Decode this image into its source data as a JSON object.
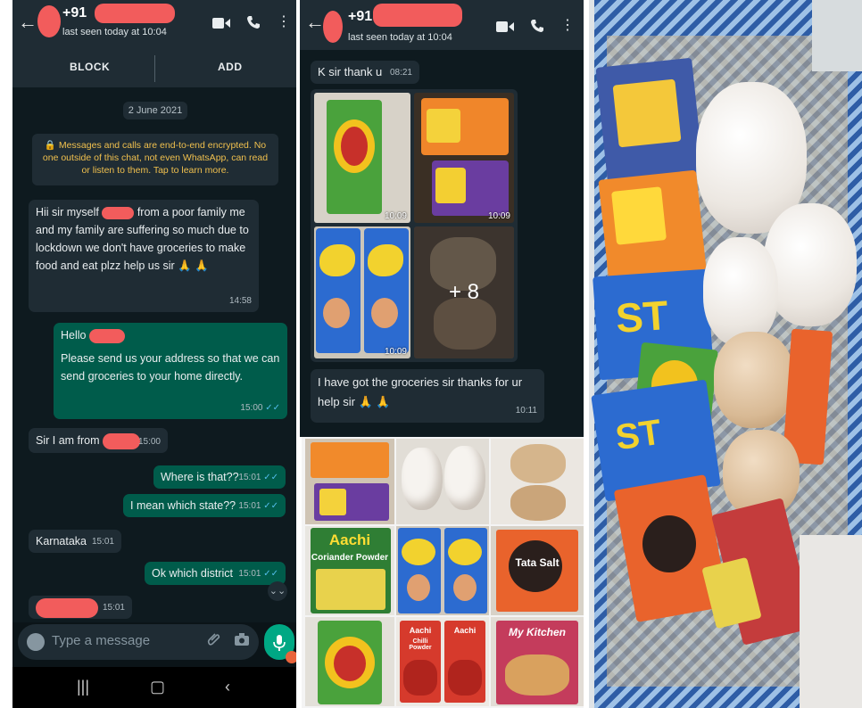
{
  "chat1": {
    "header": {
      "number_prefix": "+91",
      "last_seen": "last seen today at 10:04"
    },
    "actions": {
      "block": "BLOCK",
      "add": "ADD"
    },
    "date_chip": "2 June 2021",
    "encryption_notice": "🔒 Messages and calls are end-to-end encrypted. No one outside of this chat, not even WhatsApp, can read or listen to them. Tap to learn more.",
    "messages": [
      {
        "dir": "in",
        "text_a": "Hii sir myself",
        "text_b": "from a poor family me and my family are suffering so much due to lockdown we don't have groceries to make food and eat plzz help us sir 🙏 🙏",
        "time": "14:58"
      },
      {
        "dir": "out",
        "text_a": "Hello",
        "text_b": "Please send us your address so that we can send groceries to your home directly.",
        "time": "15:00"
      },
      {
        "dir": "in",
        "text_a": "Sir I am from",
        "time": "15:00"
      },
      {
        "dir": "out",
        "text_a": "Where is that??",
        "time": "15:01"
      },
      {
        "dir": "out",
        "text_a": "I mean which state??",
        "time": "15:01"
      },
      {
        "dir": "in",
        "text_a": "Karnataka",
        "time": "15:01"
      },
      {
        "dir": "out",
        "text_a": "Ok which district",
        "time": "15:01"
      },
      {
        "dir": "in",
        "text_a": "",
        "time": "15:01"
      }
    ],
    "composer": {
      "placeholder": "Type a message"
    }
  },
  "chat2": {
    "header": {
      "number_prefix": "+91",
      "last_seen": "last seen today at 10:04"
    },
    "msg_thanks": {
      "text": "K sir thank u",
      "time": "08:21"
    },
    "photo_times": [
      "10:09",
      "10:09",
      "10:09"
    ],
    "more_count": "+ 8",
    "msg_received": {
      "text": "I have got the groceries sir thanks for ur help sir 🙏 🙏",
      "time": "10:11"
    }
  },
  "collage": {
    "brand_1": "Aachi",
    "product_1": "Coriander Powder",
    "brand_2": "Aachi",
    "product_2": "Chilli Powder",
    "brand_3": "Aachi",
    "brand_4": "Tata Salt",
    "brand_5": "My Kitchen"
  },
  "icons": {
    "video": "video-call-icon",
    "call": "phone-icon",
    "menu": "more-vert-icon",
    "mic": "mic-icon",
    "camera": "camera-icon",
    "attach": "paperclip-icon"
  },
  "colors": {
    "header_bg": "#1f2c34",
    "chat_bg": "#0e1a1f",
    "incoming_bubble": "#1f2c34",
    "outgoing_bubble": "#005c4b",
    "accent_green": "#00a884",
    "redaction": "#f25c5c",
    "encryption_text": "#f0c04e"
  }
}
